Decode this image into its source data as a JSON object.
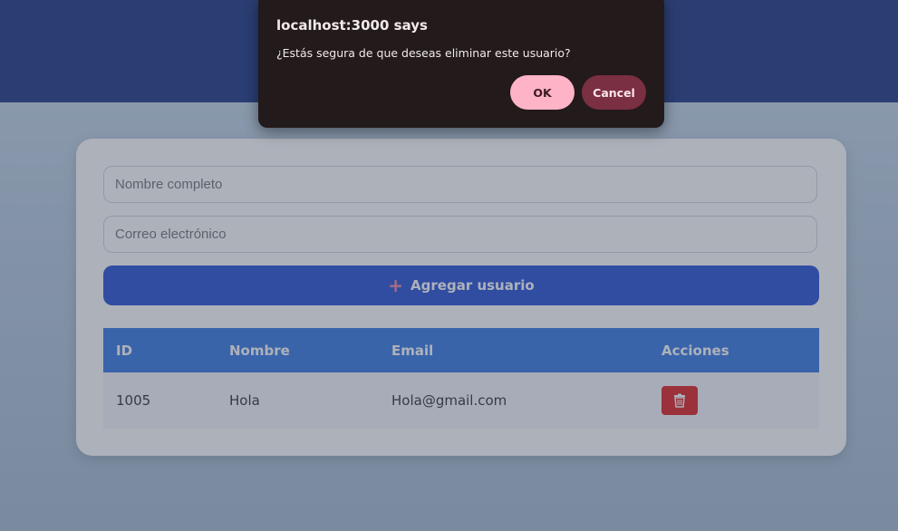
{
  "form": {
    "name_placeholder": "Nombre completo",
    "email_placeholder": "Correo electrónico",
    "add_button_label": "Agregar usuario",
    "add_icon": "plus-icon"
  },
  "table": {
    "headers": [
      "ID",
      "Nombre",
      "Email",
      "Acciones"
    ],
    "rows": [
      {
        "id": "1005",
        "name": "Hola",
        "email": "Hola@gmail.com",
        "action_icon": "trash-icon"
      }
    ]
  },
  "dialog": {
    "title": "localhost:3000 says",
    "message": "¿Estás segura de que deseas eliminar este usuario?",
    "ok_label": "OK",
    "cancel_label": "Cancel"
  },
  "colors": {
    "header_bg": "#1f3a86",
    "add_button": "#2a54d6",
    "table_header": "#3a7be4",
    "delete_button": "#e02424",
    "dialog_bg": "#221a1b",
    "ok_button": "#ffb3c6",
    "cancel_button": "#7a2f42"
  }
}
